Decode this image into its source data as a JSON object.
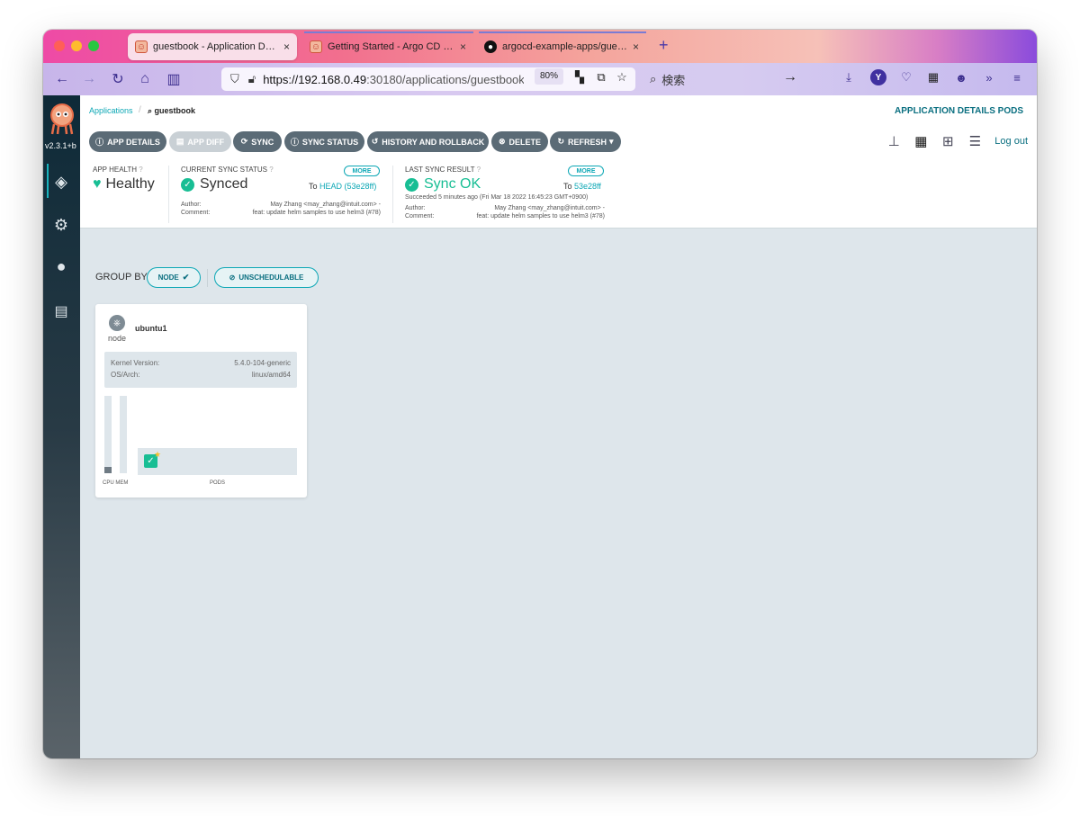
{
  "browser": {
    "tabs": [
      {
        "title": "guestbook - Application Details",
        "close": "×",
        "favicon": "argo-icon"
      },
      {
        "title": "Getting Started - Argo CD - Dec",
        "close": "×",
        "favicon": "argo-icon"
      },
      {
        "title": "argocd-example-apps/guestboo",
        "close": "×",
        "favicon": "github-icon"
      }
    ],
    "new_tab": "+",
    "url_host": "https://192.168.0.49",
    "url_rest": ":30180/applications/guestbook",
    "zoom": "80%",
    "search_placeholder": "検索"
  },
  "app": {
    "version": "v2.3.1+b",
    "breadcrumb": {
      "root": "Applications",
      "separator": "/",
      "current": "guestbook"
    },
    "top_links": "APPLICATION DETAILS PODS",
    "toolbar": {
      "app_details": "APP DETAILS",
      "app_diff": "APP DIFF",
      "sync": "SYNC",
      "sync_status": "SYNC STATUS",
      "history": "HISTORY AND ROLLBACK",
      "delete": "DELETE",
      "refresh": "REFRESH"
    },
    "logout": "Log out",
    "health": {
      "label": "APP HEALTH",
      "value": "Healthy"
    },
    "sync_status": {
      "label": "CURRENT SYNC STATUS",
      "more": "MORE",
      "value": "Synced",
      "to_prefix": "To",
      "to_ref": "HEAD (53e28ff)",
      "author_label": "Author:",
      "author": "May Zhang <may_zhang@intuit.com> -",
      "comment_label": "Comment:",
      "comment": "feat: update helm samples to use helm3 (#78)"
    },
    "last_sync": {
      "label": "LAST SYNC RESULT",
      "more": "MORE",
      "value": "Sync OK",
      "to_prefix": "To",
      "to_ref": "53e28ff",
      "when": "Succeeded 5 minutes ago (Fri Mar 18 2022 16:45:23 GMT+0900)",
      "author_label": "Author:",
      "author": "May Zhang <may_zhang@intuit.com> -",
      "comment_label": "Comment:",
      "comment": "feat: update helm samples to use helm3 (#78)"
    },
    "group_by": {
      "label": "GROUP BY:",
      "node_pill": "NODE",
      "unschedulable_pill": "UNSCHEDULABLE"
    },
    "node": {
      "name": "ubuntu1",
      "kind": "node",
      "kernel_label": "Kernel Version:",
      "kernel_value": "5.4.0-104-generic",
      "os_label": "OS/Arch:",
      "os_value": "linux/amd64",
      "cpu_mem_label": "CPU MEM",
      "pods_label": "PODS",
      "cpu_usage": 0.08,
      "mem_usage": 0.0
    }
  }
}
